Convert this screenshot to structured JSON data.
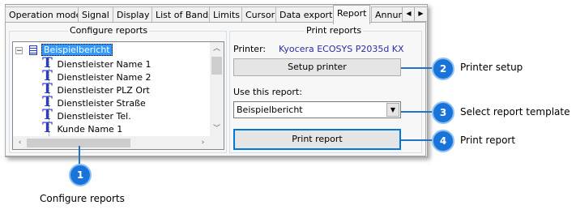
{
  "tabs": [
    {
      "label": "Operation mode",
      "active": false
    },
    {
      "label": "Signal",
      "active": false
    },
    {
      "label": "Display",
      "active": false
    },
    {
      "label": "List of Bands",
      "active": false
    },
    {
      "label": "Limits",
      "active": false
    },
    {
      "label": "Cursor",
      "active": false
    },
    {
      "label": "Data export",
      "active": false
    },
    {
      "label": "Report",
      "active": true
    },
    {
      "label": "Annun",
      "active": false
    }
  ],
  "configure_reports": {
    "title": "Configure reports",
    "root": "Beispielbericht",
    "items": [
      "Dienstleister Name 1",
      "Dienstleister Name 2",
      "Dienstleister PLZ Ort",
      "Dienstleister Straße",
      "Dienstleister Tel.",
      "Kunde Name 1"
    ]
  },
  "print_reports": {
    "title": "Print reports",
    "printer_label": "Printer:",
    "printer_name": "Kyocera ECOSYS P2035d KX",
    "setup_button": "Setup printer",
    "use_report_label": "Use this report:",
    "selected_report": "Beispielbericht",
    "print_button": "Print report"
  },
  "callouts": [
    {
      "number": "1",
      "label": "Configure reports"
    },
    {
      "number": "2",
      "label": "Printer setup"
    },
    {
      "number": "3",
      "label": "Select report template"
    },
    {
      "number": "4",
      "label": "Print report"
    }
  ],
  "colors": {
    "accent": "#1a73d8",
    "printer_name": "#2c2ca8",
    "selection": "#3399ff"
  }
}
